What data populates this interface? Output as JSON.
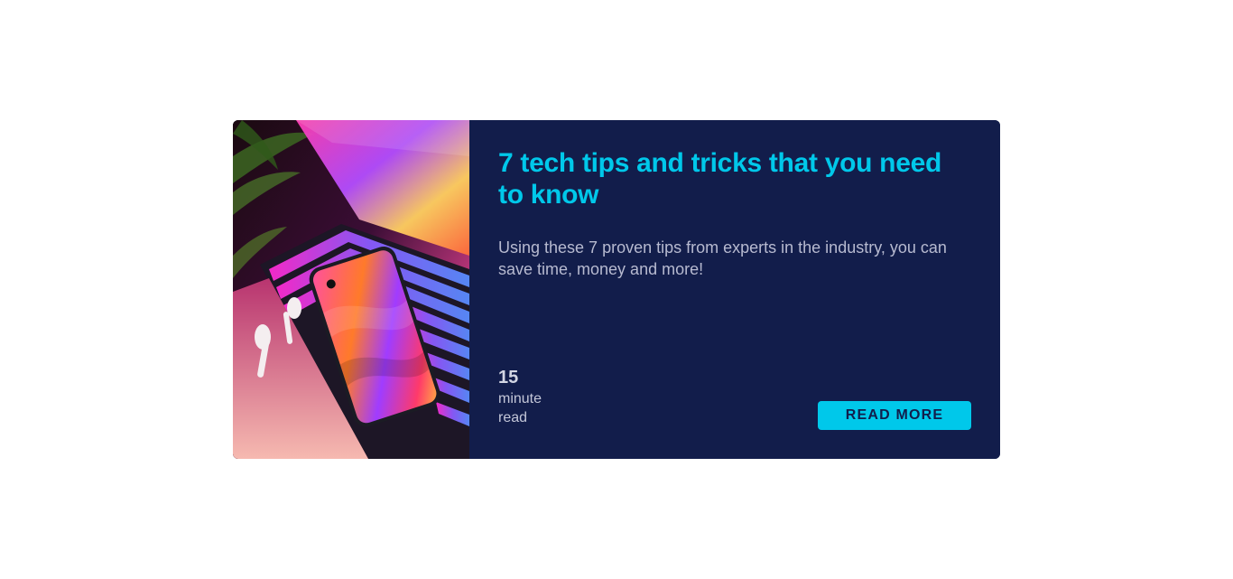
{
  "card": {
    "title": "7 tech tips and tricks that you need to know",
    "description": "Using these 7 proven tips from experts in the industry, you can save time, money and more!",
    "read_time": {
      "value": "15",
      "unit_line1": "minute",
      "unit_line2": "read"
    },
    "button_label": "READ MORE"
  },
  "colors": {
    "card_background": "#121d4b",
    "accent": "#00c8ea",
    "text_muted": "#b7bad0",
    "page_background": "#ffffff"
  }
}
